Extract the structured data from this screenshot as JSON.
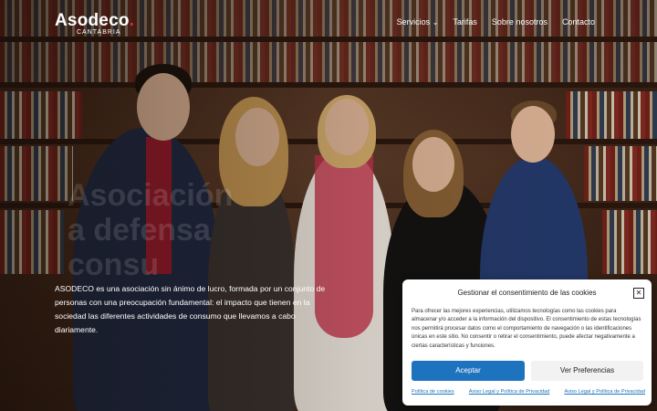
{
  "logo": {
    "name": "Asodeco",
    "dot": ".",
    "sub": "CANTABRIA"
  },
  "nav": {
    "items": [
      {
        "label": "Servicios"
      },
      {
        "label": "Tarifas"
      },
      {
        "label": "Sobre nosotros"
      },
      {
        "label": "Contacto"
      }
    ],
    "dropdown_glyph": "⌄"
  },
  "hero": {
    "ghost_text": [
      "Asociación",
      "a defensa",
      "consu"
    ],
    "intro": "ASODECO es una asociación sin ánimo de lucro, formada por un conjunto de personas con una preocupación fundamental: el impacto que tienen en la sociedad las diferentes actividades de consumo que llevamos a cabo diariamente."
  },
  "cookie": {
    "title": "Gestionar el consentimiento de las cookies",
    "close_glyph": "✕",
    "body": "Para ofrecer las mejores experiencias, utilizamos tecnologías como las cookies para almacenar y/o acceder a la información del dispositivo. El consentimiento de estas tecnologías nos permitirá procesar datos como el comportamiento de navegación o las identificaciones únicas en este sitio. No consentir o retirar el consentimiento, puede afectar negativamente a ciertas características y funciones.",
    "accept_label": "Aceptar",
    "prefs_label": "Ver Preferencias",
    "links": [
      "Política de cookies",
      "Aviso Legal y Política de Privacidad",
      "Aviso Legal y Política de Privacidad"
    ],
    "accent": "#1e73be"
  }
}
